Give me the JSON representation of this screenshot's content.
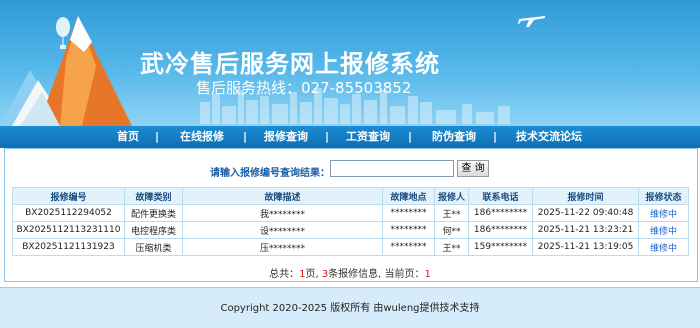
{
  "header": {
    "title": "武冷售后服务网上报修系统",
    "hotline": "售后服务热线：027-85503852"
  },
  "nav": {
    "items": [
      {
        "label": "首页"
      },
      {
        "label": "在线报修"
      },
      {
        "label": "报修查询"
      },
      {
        "label": "工资查询"
      },
      {
        "label": "防伪查询"
      },
      {
        "label": "技术交流论坛"
      }
    ],
    "separator": "|"
  },
  "search": {
    "label": "请输入报修编号查询结果：",
    "value": "",
    "button_label": "查 询"
  },
  "table": {
    "headers": [
      "报修编号",
      "故障类别",
      "故障描述",
      "故障地点",
      "报修人",
      "联系电话",
      "报修时间",
      "报修状态"
    ],
    "rows": [
      [
        "BX2025112294052",
        "配件更换类",
        "我********",
        "********",
        "王**",
        "186********",
        "2025-11-22 09:40:48",
        "维修中"
      ],
      [
        "BX2025112113231110",
        "电控程序类",
        "设********",
        "********",
        "何**",
        "186********",
        "2025-11-21 13:23:21",
        "维修中"
      ],
      [
        "BX20251121131923",
        "压缩机类",
        "压********",
        "********",
        "王**",
        "159********",
        "2025-11-21 13:19:05",
        "维修中"
      ]
    ]
  },
  "pager": {
    "prefix": "总共：",
    "total_pages": "1",
    "middle1": "页, ",
    "total_records": "3",
    "middle2": "条报修信息, 当前页：",
    "current_page": "1"
  },
  "footer": {
    "text": "Copyright 2020-2025 版权所有 由wuleng提供技术支持"
  },
  "colors": {
    "banner": "#3fa8e2",
    "nav": "#1577c0",
    "link": "#1a5fd0",
    "accent_red": "#e0141e"
  }
}
